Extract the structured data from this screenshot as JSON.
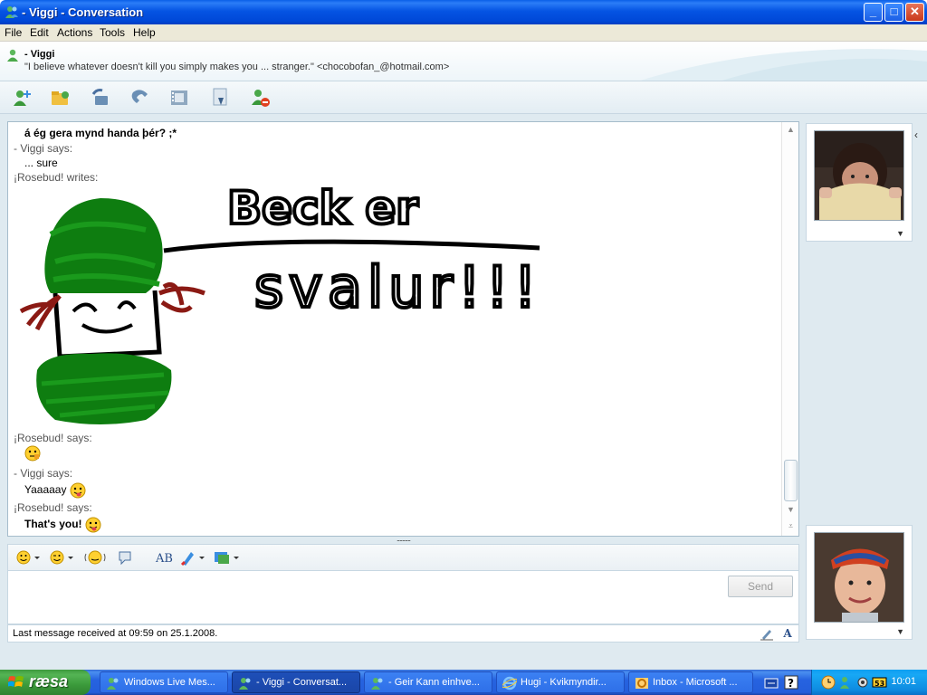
{
  "window": {
    "title": "- Viggi - Conversation",
    "buttons": {
      "minimize": "_",
      "maximize": "□",
      "close": "✕"
    }
  },
  "menu": [
    "File",
    "Edit",
    "Actions",
    "Tools",
    "Help"
  ],
  "contact": {
    "name": "- Viggi",
    "personal_message": "\"I believe whatever doesn't kill you simply makes you ... stranger.\" <chocobofan_@hotmail.com>"
  },
  "toolbar": {
    "icons": [
      "invite-contact-icon",
      "share-files-icon",
      "call-icon",
      "phone-icon",
      "video-icon",
      "activities-icon",
      "block-icon"
    ]
  },
  "conversation": {
    "lines": [
      {
        "kind": "message",
        "bold": true,
        "text": "á ég gera mynd handa þér? ;*"
      },
      {
        "kind": "sender",
        "text": "- Viggi says:"
      },
      {
        "kind": "message",
        "bold": false,
        "text": "... sure"
      },
      {
        "kind": "sender",
        "text": "¡Rosebud! writes:"
      }
    ],
    "handwriting": {
      "line1": "Beck er",
      "line2": "svalur!!!"
    },
    "after_drawing": [
      {
        "kind": "sender",
        "text": "¡Rosebud! says:"
      },
      {
        "kind": "emoticon",
        "text": "",
        "emoticon": "thinking-emoticon"
      },
      {
        "kind": "sender",
        "text": "- Viggi says:"
      },
      {
        "kind": "message",
        "bold": false,
        "text": "Yaaaaay",
        "emoticon": "tongue-out-emoticon"
      },
      {
        "kind": "sender",
        "text": "¡Rosebud! says:"
      },
      {
        "kind": "message",
        "bold": true,
        "text": "That's you!",
        "emoticon": "tongue-out-emoticon"
      }
    ]
  },
  "splitter": "..........",
  "format_bar": {
    "icons": [
      "emoticon-icon",
      "wink-icon",
      "nudge-icon",
      "voice-clip-icon",
      "font-icon",
      "background-icon",
      "handwriting-icon"
    ]
  },
  "input": {
    "value": ""
  },
  "send_label": "Send",
  "status": {
    "text": "Last message received at 09:59 on 25.1.2008."
  },
  "taskbar": {
    "start_label": "ræsa",
    "tasks": [
      {
        "label": "Windows Live Mes...",
        "active": false
      },
      {
        "label": "- Viggi - Conversat...",
        "active": true
      },
      {
        "label": "- Geir Kann einhve...",
        "active": false
      },
      {
        "label": "Hugi - Kvikmyndir...",
        "active": false
      },
      {
        "label": "Inbox - Microsoft ...",
        "active": false
      }
    ],
    "clock": "10:01"
  },
  "colors": {
    "titlebar": "#0554e3",
    "green_ink": "#0e7d10",
    "red_ink": "#8b1a14",
    "accent": "#c7d7e2"
  }
}
